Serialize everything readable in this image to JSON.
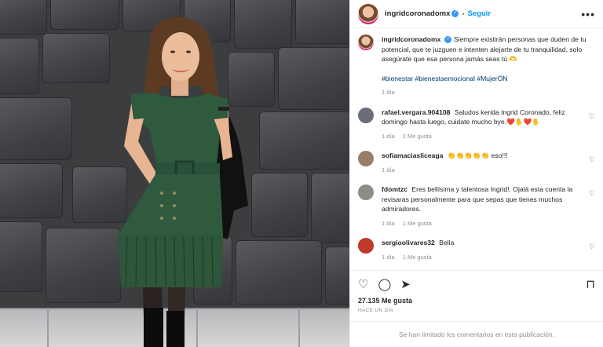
{
  "post": {
    "username": "ingridcoronadomx",
    "follow_label": "Seguir",
    "more_label": "•••",
    "caption": "Siempre existirán personas que duden de tu potencial, que te juzguen e intenten alejarte de tu tranquilidad, solo asegúrate que esa persona jamás seas tú 🫶",
    "hashtags": "#bienestar #bienestaemocional #MujerÓN",
    "time": "1 día"
  },
  "comments": [
    {
      "user": "rafael.vergara.904108",
      "text": "Saludos kerida Ingrid Coronado, feliz domingo hasta luego, cuidate mucho bye.❤️✋❤️✋",
      "time": "1 día",
      "likes": "2 Me gusta",
      "avatar_color": "#6b6e7a"
    },
    {
      "user": "sofiamaciasliceaga",
      "text": "👏👏👏👏👏 eso!!!",
      "time": "1 día",
      "likes": "",
      "avatar_color": "#9a7d68"
    },
    {
      "user": "fdomtzc",
      "text": "Eres bellísima y talentosa Ingrid!. Ojalá esta cuenta la revisaras personalmente para que sepas que tienes muchos admiradores.",
      "time": "1 día",
      "likes": "1 Me gusta",
      "avatar_color": "#8a8f86"
    },
    {
      "user": "sergioolivares32",
      "text": "Bella",
      "time": "1 día",
      "likes": "1 Me gusta",
      "avatar_color": "#c0392b"
    }
  ],
  "footer": {
    "likes": "27.135 Me gusta",
    "ago": "HACE UN DÍA",
    "limited": "Se han limitado los comentarios en esta publicación."
  },
  "icons": [
    "heart-icon",
    "comment-icon",
    "share-icon",
    "bookmark-icon",
    "verified-icon",
    "more-icon"
  ]
}
